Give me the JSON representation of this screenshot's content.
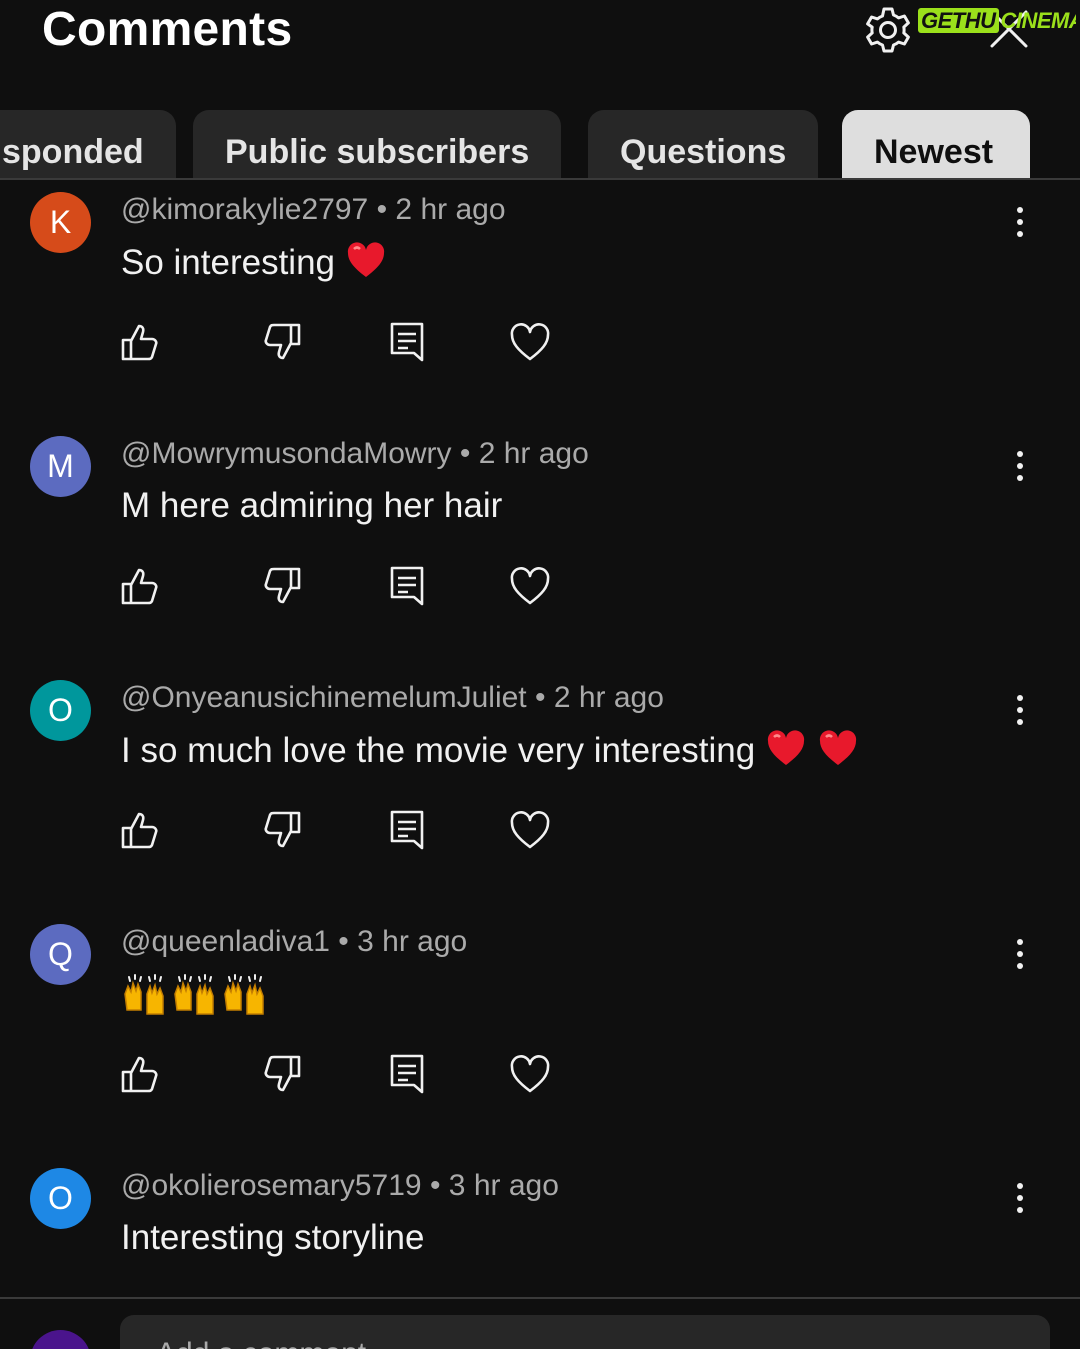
{
  "header": {
    "title": "Comments"
  },
  "watermark": {
    "part1": "GETHU",
    "part2": "CINEMA"
  },
  "chips": [
    {
      "label": "sponded",
      "active": false
    },
    {
      "label": "Public subscribers",
      "active": false
    },
    {
      "label": "Questions",
      "active": false
    },
    {
      "label": "Newest",
      "active": true
    }
  ],
  "comments": [
    {
      "initial": "K",
      "avatar_color": "#d64b1a",
      "handle": "@kimorakylie2797",
      "time": "2 hr ago",
      "text": "So interesting",
      "emoji": [
        "red-heart"
      ]
    },
    {
      "initial": "M",
      "avatar_color": "#5c6bc0",
      "handle": "@MowrymusondaMowry",
      "time": "2 hr ago",
      "text": "M here admiring her hair",
      "emoji": []
    },
    {
      "initial": "O",
      "avatar_color": "#00979c",
      "handle": "@OnyeanusichinemelumJuliet",
      "time": "2 hr ago",
      "text": "I so much love the movie very interesting",
      "emoji": [
        "red-heart",
        "red-heart"
      ]
    },
    {
      "initial": "Q",
      "avatar_color": "#5c6bc0",
      "handle": "@queenladiva1",
      "time": "3 hr ago",
      "text": "",
      "emoji": [
        "raising-hands",
        "raising-hands",
        "raising-hands"
      ]
    },
    {
      "initial": "O",
      "avatar_color": "#1e88e5",
      "handle": "@okolierosemary5719",
      "time": "3 hr ago",
      "text": "Interesting storyline",
      "emoji": []
    }
  ],
  "composer": {
    "placeholder": "Add a comment...",
    "avatar_color": "#4a148c"
  },
  "icons": {
    "settings": "gear-icon",
    "close": "close-icon",
    "like": "thumbs-up-icon",
    "dislike": "thumbs-down-icon",
    "reply": "reply-icon",
    "heart": "heart-icon",
    "more": "more-vertical-icon"
  }
}
